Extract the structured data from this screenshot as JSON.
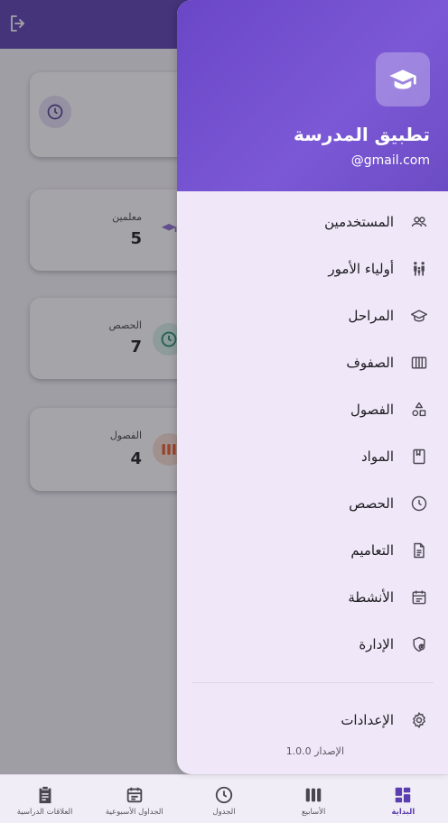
{
  "colors": {
    "primary": "#5b3fb0",
    "drawer_bg": "#f0e8f8",
    "header_gradient": "#7b58d6"
  },
  "background": {
    "cards": [
      {
        "label": "",
        "value": "",
        "icon": "clock-icon",
        "icon_color": "#6a5fb0"
      },
      {
        "label": "معلمين",
        "value": "5",
        "icon": "graduation-cap-icon",
        "icon_color": "#8a6fd0"
      },
      {
        "label": "الحصص",
        "value": "7",
        "icon": "clock-icon",
        "icon_color": "#1f8a6a"
      },
      {
        "label": "الفصول",
        "value": "4",
        "icon": "columns-icon",
        "icon_color": "#e65a2a"
      }
    ]
  },
  "drawer": {
    "title": "تطبيق المدرسة",
    "email": "@gmail.com",
    "items": [
      {
        "label": "المستخدمين",
        "icon": "users-icon"
      },
      {
        "label": "أولياء الأمور",
        "icon": "family-icon"
      },
      {
        "label": "المراحل",
        "icon": "graduation-cap-icon"
      },
      {
        "label": "الصفوف",
        "icon": "columns-icon"
      },
      {
        "label": "الفصول",
        "icon": "shapes-icon"
      },
      {
        "label": "المواد",
        "icon": "book-icon"
      },
      {
        "label": "الحصص",
        "icon": "clock-icon"
      },
      {
        "label": "التعاميم",
        "icon": "document-icon"
      },
      {
        "label": "الأنشطة",
        "icon": "calendar-icon"
      },
      {
        "label": "الإدارة",
        "icon": "admin-shield-icon"
      }
    ],
    "settings_label": "الإعدادات",
    "version": "الإصدار 1.0.0"
  },
  "bottom_nav": [
    {
      "label": "البداية",
      "icon": "dashboard-icon",
      "active": true
    },
    {
      "label": "الأسابيع",
      "icon": "weeks-columns-icon"
    },
    {
      "label": "الجدول",
      "icon": "clock-icon"
    },
    {
      "label": "الجداول الأسبوعية",
      "icon": "calendar-icon"
    },
    {
      "label": "العلاقات الدراسية",
      "icon": "clipboard-icon"
    }
  ]
}
